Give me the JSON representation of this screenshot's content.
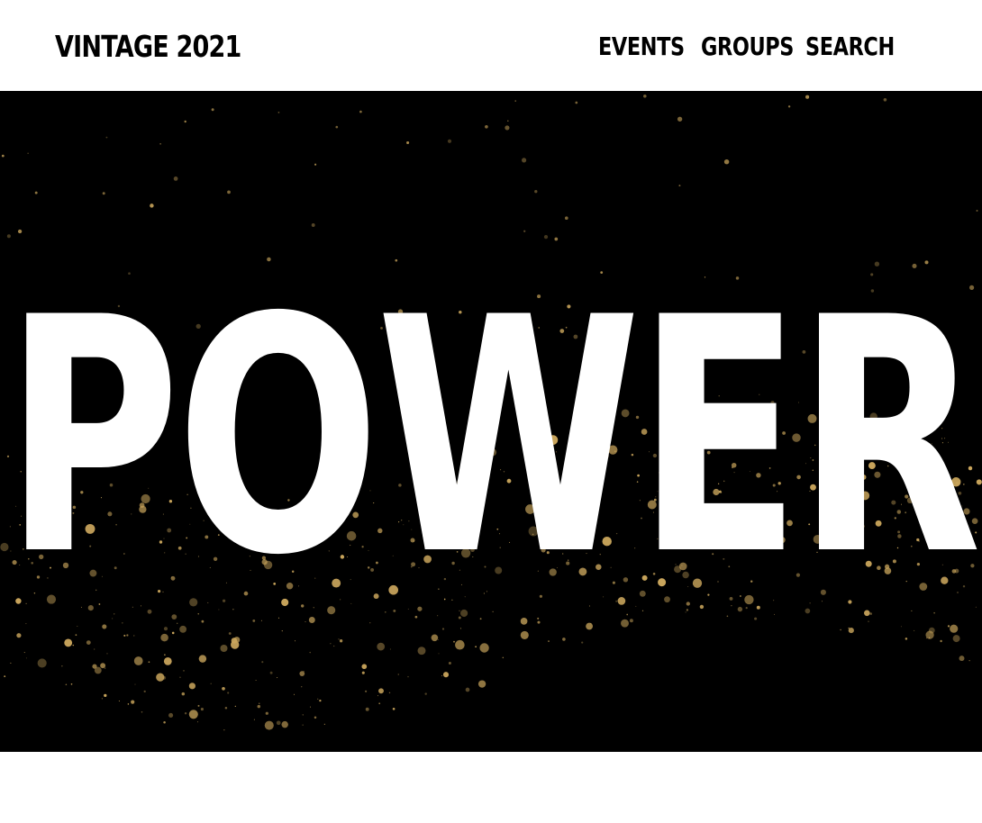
{
  "header": {
    "brand": "VINTAGE 2021",
    "nav": [
      {
        "label": "EVENTS"
      },
      {
        "label": "GROUPS"
      },
      {
        "label": "SEARCH"
      }
    ]
  },
  "hero": {
    "headline": "POWER",
    "background_color": "#000000",
    "headline_color": "#ffffff",
    "sparkle_color": "#c9a55c"
  }
}
